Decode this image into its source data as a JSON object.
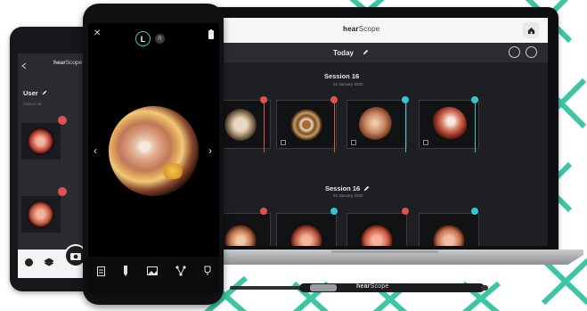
{
  "brand_color": "#3cc6a5",
  "laptop": {
    "logo_prefix": "hear",
    "logo_suffix": "Scope",
    "home_icon": "home-icon",
    "header_title": "Today",
    "edit_icon": "pencil-icon",
    "sessions": [
      {
        "title": "Session 16",
        "date": "22 January 2020",
        "tiles": [
          {
            "badge": "red",
            "img": "rim"
          },
          {
            "badge": "red",
            "img": "debris"
          },
          {
            "badge": "teal",
            "img": "canal"
          },
          {
            "badge": "teal",
            "img": "flesh"
          }
        ]
      },
      {
        "title": "Session 16",
        "date": "22 January 2020",
        "tiles": [
          {
            "badge": "red",
            "img": "rim"
          },
          {
            "badge": "teal",
            "img": "canal"
          },
          {
            "badge": "red",
            "img": "flesh"
          },
          {
            "badge": "teal",
            "img": "canal"
          }
        ]
      }
    ]
  },
  "otoscope": {
    "label_prefix": "hear",
    "label_suffix": "Scope"
  },
  "phone_back": {
    "logo_prefix": "hear",
    "logo_suffix": "Scope",
    "user_label": "User",
    "date_label": "2020-01-16",
    "bottom_icons": [
      "info-icon",
      "stack-icon",
      "camera-icon"
    ]
  },
  "phone_front": {
    "ear_side_selected": "L",
    "ear_side_other": "R",
    "left_arrow": "‹",
    "right_arrow": "›",
    "close_glyph": "✕",
    "toolbar_icons": [
      "file-icon",
      "pen-icon",
      "image-icon",
      "share-icon",
      "clipboard-icon"
    ]
  }
}
